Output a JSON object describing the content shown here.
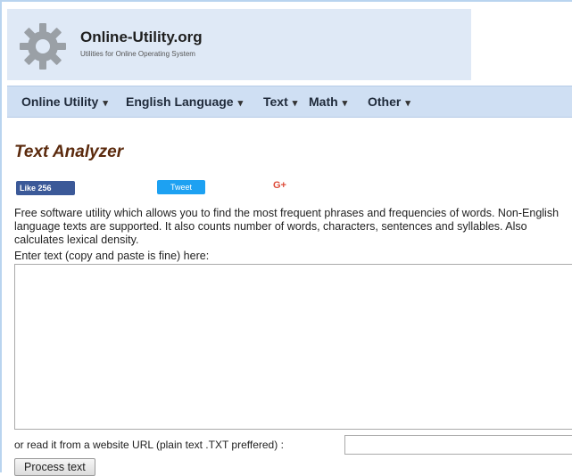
{
  "header": {
    "site_name": "Online-Utility.org",
    "tagline": "Utilities for Online Operating System",
    "logo_icon": "gear-icon"
  },
  "nav": {
    "items": [
      {
        "label": "Online Utility",
        "caret": "▾"
      },
      {
        "label": "English Language",
        "caret": "▾"
      },
      {
        "label": "Text",
        "caret": "▾"
      },
      {
        "label": "Math",
        "caret": "▾"
      },
      {
        "label": "Other",
        "caret": "▾"
      }
    ]
  },
  "page": {
    "title": "Text Analyzer",
    "description": "Free software utility which allows you to find the most frequent phrases and frequencies of words. Non-English language texts are supported. It also counts number of words, characters, sentences and syllables. Also calculates lexical density."
  },
  "social": {
    "like_label": "Like 256",
    "tweet_label": "Tweet",
    "gplus_label": "G+"
  },
  "form": {
    "text_label": "Enter text (copy and paste is fine) here:",
    "text_value": "",
    "url_label": "or read it from a website URL (plain text .TXT preffered) :",
    "url_value": "",
    "submit_label": "Process text"
  },
  "colors": {
    "header_bg": "#dfe9f6",
    "nav_bg": "#cfdff3",
    "title": "#5b2a0d",
    "facebook": "#3b5998",
    "twitter": "#1da1f2",
    "gplus": "#dd4b39"
  }
}
